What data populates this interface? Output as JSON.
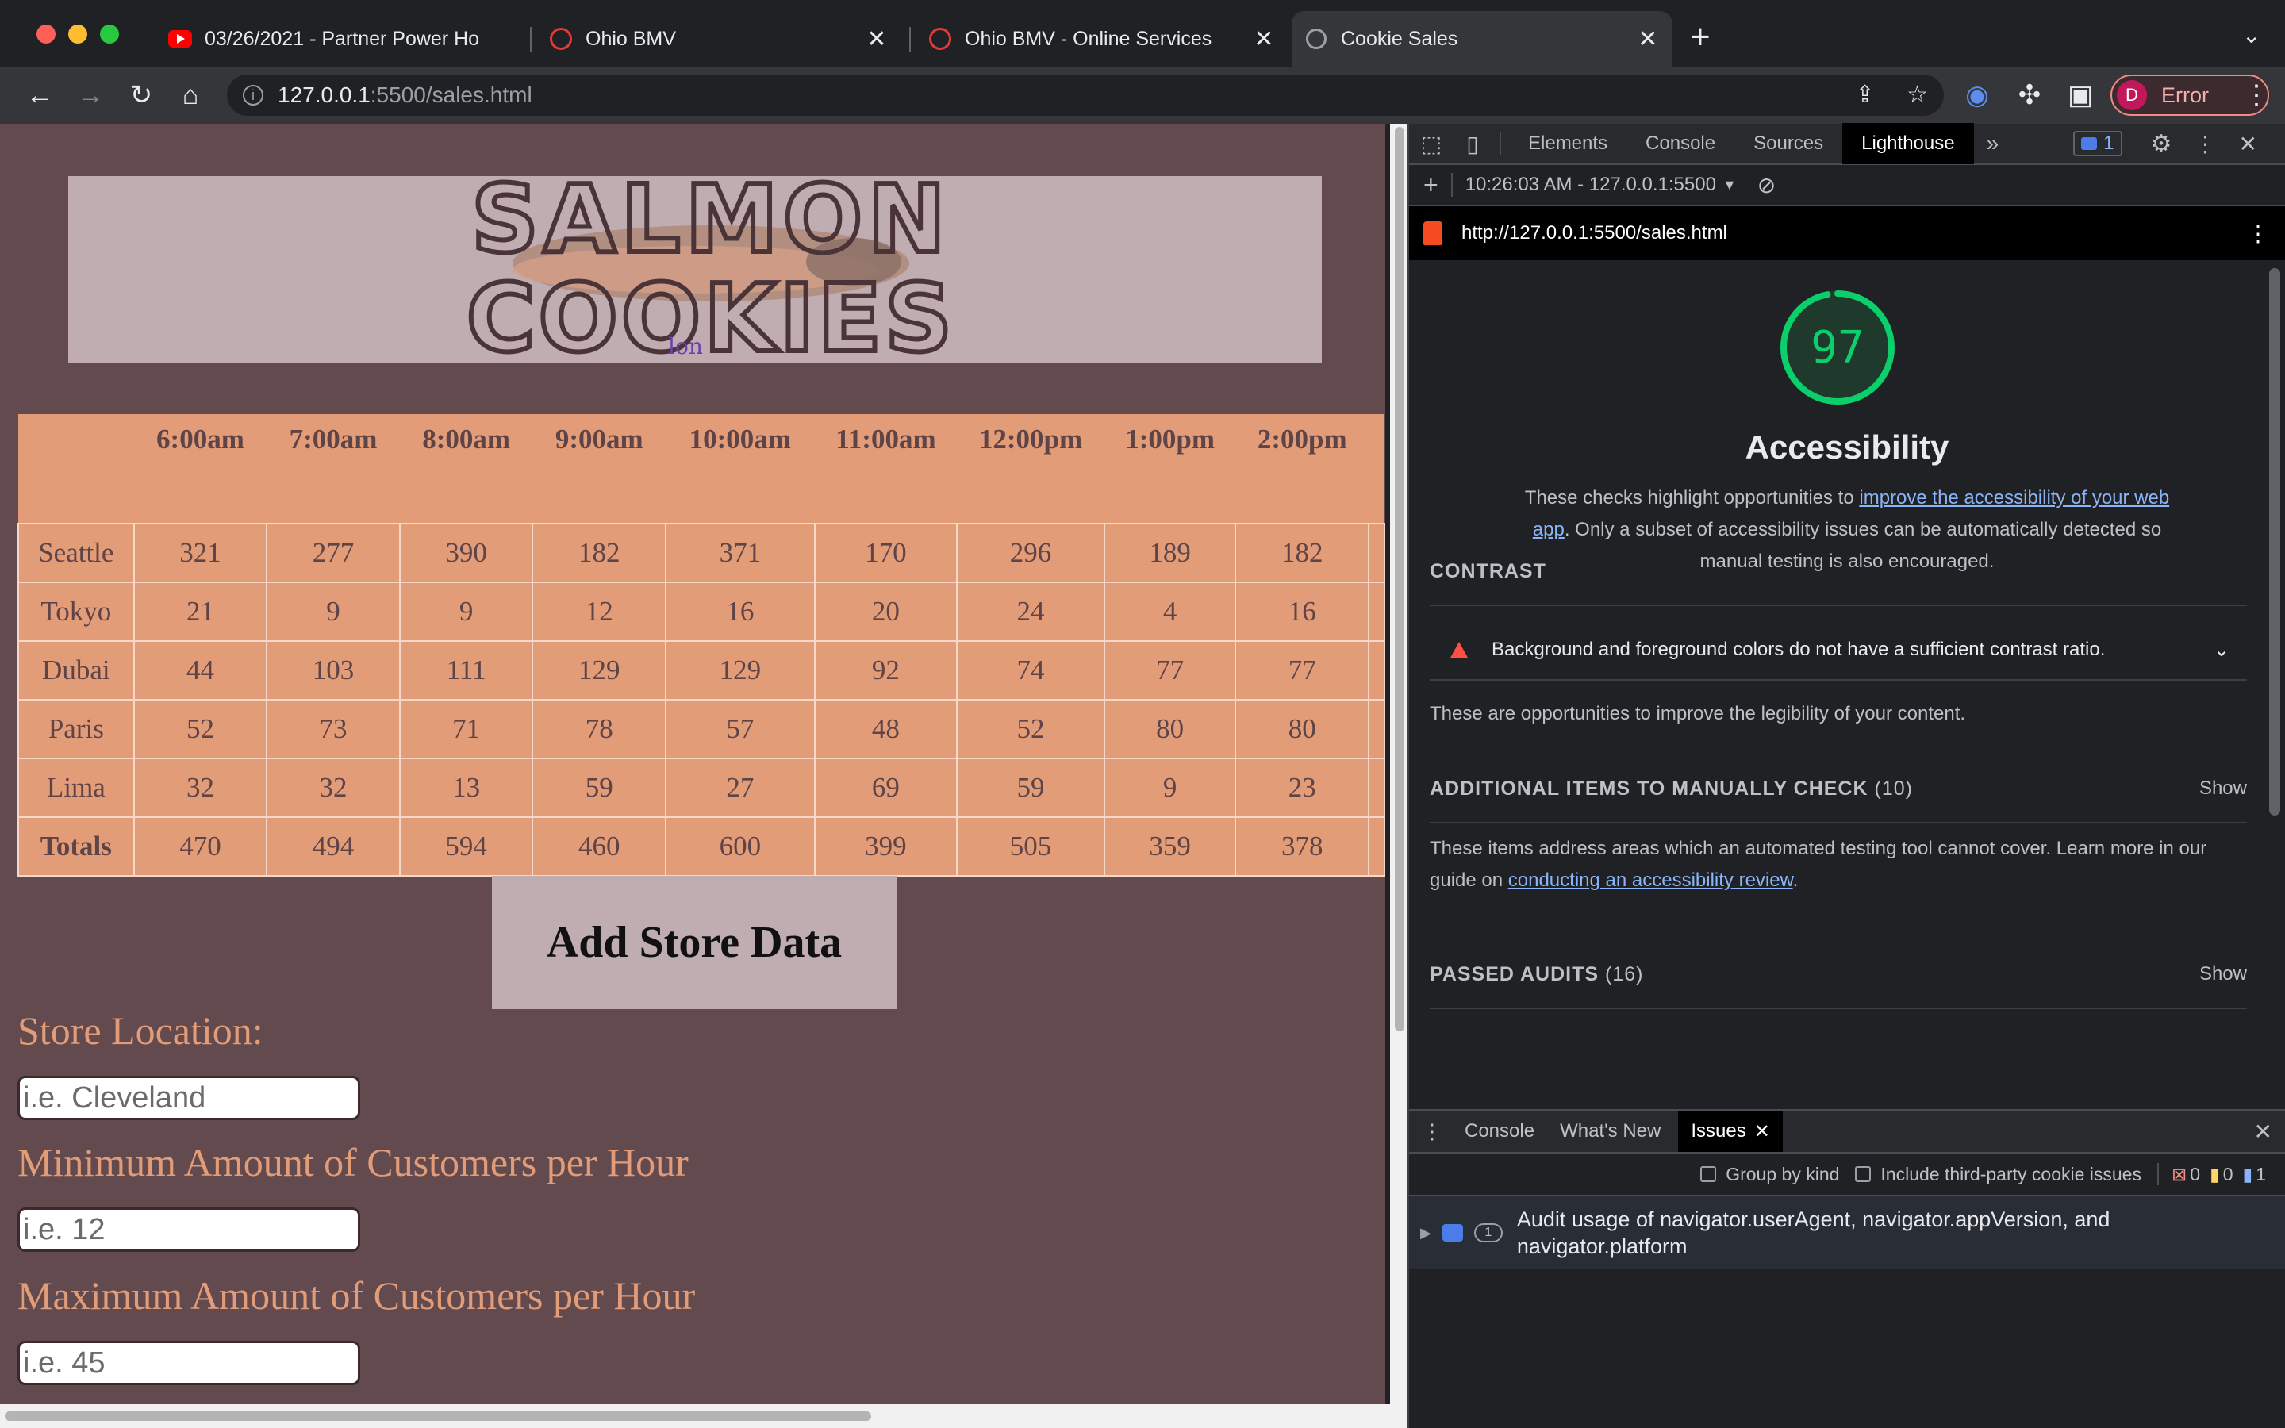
{
  "browser": {
    "tabs": [
      {
        "title": "03/26/2021 - Partner Power Ho",
        "favicon": "youtube-icon"
      },
      {
        "title": "Ohio BMV",
        "favicon": "ohio-bmv-icon"
      },
      {
        "title": "Ohio BMV - Online Services",
        "favicon": "ohio-bmv-icon"
      },
      {
        "title": "Cookie Sales",
        "favicon": "globe-icon",
        "active": true
      }
    ],
    "url_host": "127.0.0.1",
    "url_rest": ":5500/sales.html",
    "profile_initial": "D",
    "profile_label": "Error"
  },
  "page": {
    "logo_line1": "SALMON",
    "logo_line2": "COOKIES",
    "logo_overlap_text": "lon",
    "table": {
      "hours": [
        "6:00am",
        "7:00am",
        "8:00am",
        "9:00am",
        "10:00am",
        "11:00am",
        "12:00pm",
        "1:00pm",
        "2:00pm"
      ],
      "rows": [
        {
          "name": "Seattle",
          "values": [
            "321",
            "277",
            "390",
            "182",
            "371",
            "170",
            "296",
            "189",
            "182"
          ]
        },
        {
          "name": "Tokyo",
          "values": [
            "21",
            "9",
            "9",
            "12",
            "16",
            "20",
            "24",
            "4",
            "16"
          ]
        },
        {
          "name": "Dubai",
          "values": [
            "44",
            "103",
            "111",
            "129",
            "129",
            "92",
            "74",
            "77",
            "77"
          ]
        },
        {
          "name": "Paris",
          "values": [
            "52",
            "73",
            "71",
            "78",
            "57",
            "48",
            "52",
            "80",
            "80"
          ]
        },
        {
          "name": "Lima",
          "values": [
            "32",
            "32",
            "13",
            "59",
            "27",
            "69",
            "59",
            "9",
            "23"
          ]
        }
      ],
      "totals": {
        "name": "Totals",
        "values": [
          "470",
          "494",
          "594",
          "460",
          "600",
          "399",
          "505",
          "359",
          "378"
        ]
      }
    },
    "add_button": "Add Store Data",
    "form": {
      "location_label": "Store Location:",
      "location_placeholder": "i.e. Cleveland",
      "min_label": "Minimum Amount of Customers per Hour",
      "min_placeholder": "i.e. 12",
      "max_label": "Maximum Amount of Customers per Hour",
      "max_placeholder": "i.e. 45"
    }
  },
  "devtools": {
    "tabs": [
      "Elements",
      "Console",
      "Sources",
      "Lighthouse"
    ],
    "active_tab": "Lighthouse",
    "issues_badge": "1",
    "report_selector": "10:26:03 AM - 127.0.0.1:5500",
    "report_url": "http://127.0.0.1:5500/sales.html",
    "score": "97",
    "score_fraction": 0.97,
    "category_title": "Accessibility",
    "desc_before": "These checks highlight opportunities to ",
    "desc_link": "improve the accessibility of your web app",
    "desc_after": ". Only a subset of accessibility issues can be automatically detected so manual testing is also encouraged.",
    "contrast_heading": "CONTRAST",
    "contrast_audit": "Background and foreground colors do not have a sufficient contrast ratio.",
    "contrast_note": "These are opportunities to improve the legibility of your content.",
    "manual_heading": "ADDITIONAL ITEMS TO MANUALLY CHECK",
    "manual_count": "(10)",
    "show_label": "Show",
    "manual_desc_before": "These items address areas which an automated testing tool cannot cover. Learn more in our guide on ",
    "manual_link": "conducting an accessibility review",
    "manual_desc_after": ".",
    "passed_heading": "PASSED AUDITS",
    "passed_count": "(16)",
    "drawer_tabs": [
      "Console",
      "What's New",
      "Issues"
    ],
    "group_by_kind": "Group by kind",
    "third_party": "Include third-party cookie issues",
    "err_count": "0",
    "warn_count": "0",
    "info_count": "1",
    "issue_text": "Audit usage of navigator.userAgent, navigator.appVersion, and navigator.platform",
    "issue_count": "1",
    "accent_color": "#0cce6b"
  }
}
